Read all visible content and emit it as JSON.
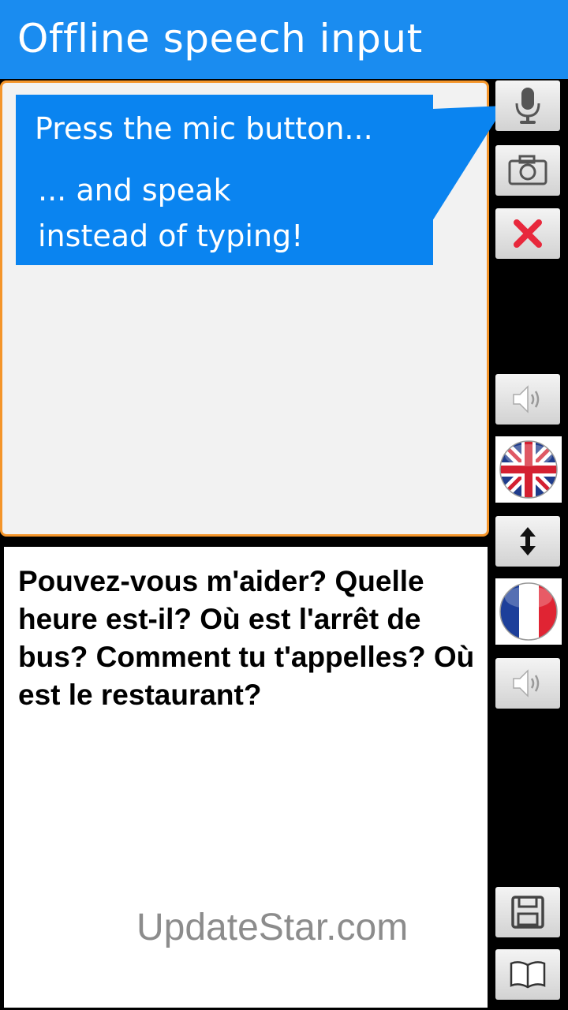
{
  "app": {
    "title": "Offline speech input"
  },
  "hint": {
    "line1": "Press the mic button...",
    "line2": "... and speak",
    "line3": "instead of typing!"
  },
  "translation": {
    "text": "Pouvez-vous m'aider? Quelle heure est-il? Où est l'arrêt de bus? Comment tu t'appelles? Où est le restaurant?"
  },
  "watermark": "UpdateStar.com",
  "sidebar": {
    "buttons": [
      {
        "name": "mic",
        "icon": "microphone-icon"
      },
      {
        "name": "camera",
        "icon": "camera-icon"
      },
      {
        "name": "clear",
        "icon": "close-icon"
      },
      {
        "name": "speak-source",
        "icon": "speaker-icon"
      },
      {
        "name": "source-language",
        "icon": "uk-flag-icon"
      },
      {
        "name": "swap",
        "icon": "swap-vertical-icon"
      },
      {
        "name": "target-language",
        "icon": "france-flag-icon"
      },
      {
        "name": "speak-target",
        "icon": "speaker-icon"
      },
      {
        "name": "save",
        "icon": "floppy-disk-icon"
      },
      {
        "name": "phrasebook",
        "icon": "book-icon"
      }
    ]
  },
  "colors": {
    "titlebar": "#1a8cf0",
    "hint": "#0a84f0",
    "panel_border": "#f4952a",
    "clear_icon": "#e8283c"
  }
}
